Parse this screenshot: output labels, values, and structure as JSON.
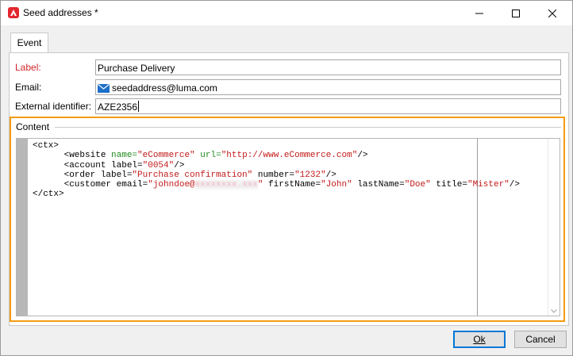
{
  "window": {
    "title": "Seed addresses *"
  },
  "tabs": [
    {
      "label": "Event"
    }
  ],
  "form": {
    "label": {
      "label": "Label:",
      "value": "Purchase Delivery"
    },
    "email": {
      "label": "Email:",
      "value": "seedaddress@luma.com"
    },
    "external_id": {
      "label": "External identifier:",
      "value": "AZE2356"
    }
  },
  "content": {
    "legend": "Content",
    "lines": {
      "l1": "<ctx>",
      "l2_a": "      <website ",
      "l2_b": "name=",
      "l2_c": "\"eCommerce\"",
      "l2_d": " url=",
      "l2_e": "\"http://www.eCommerce.com\"",
      "l2_f": "/>",
      "l3_a": "      <account label=",
      "l3_b": "\"0054\"",
      "l3_c": "/>",
      "l4_a": "      <order label=",
      "l4_b": "\"Purchase confirmation\"",
      "l4_c": " number=",
      "l4_d": "\"1232\"",
      "l4_e": "/>",
      "l5_a": "      <customer email=",
      "l5_b": "\"johndoe@",
      "l5_c": "xxxxxxxx.xxx",
      "l5_d": "\"",
      "l5_e": " firstName=",
      "l5_f": "\"John\"",
      "l5_g": " lastName=",
      "l5_h": "\"Doe\"",
      "l5_i": " title=",
      "l5_j": "\"Mister\"",
      "l5_k": "/>",
      "l6": "</ctx>"
    }
  },
  "buttons": {
    "ok": "Ok",
    "cancel": "Cancel"
  },
  "colors": {
    "accent": "#f39c12",
    "required": "#d0262b",
    "app_icon": "#e3262e"
  }
}
